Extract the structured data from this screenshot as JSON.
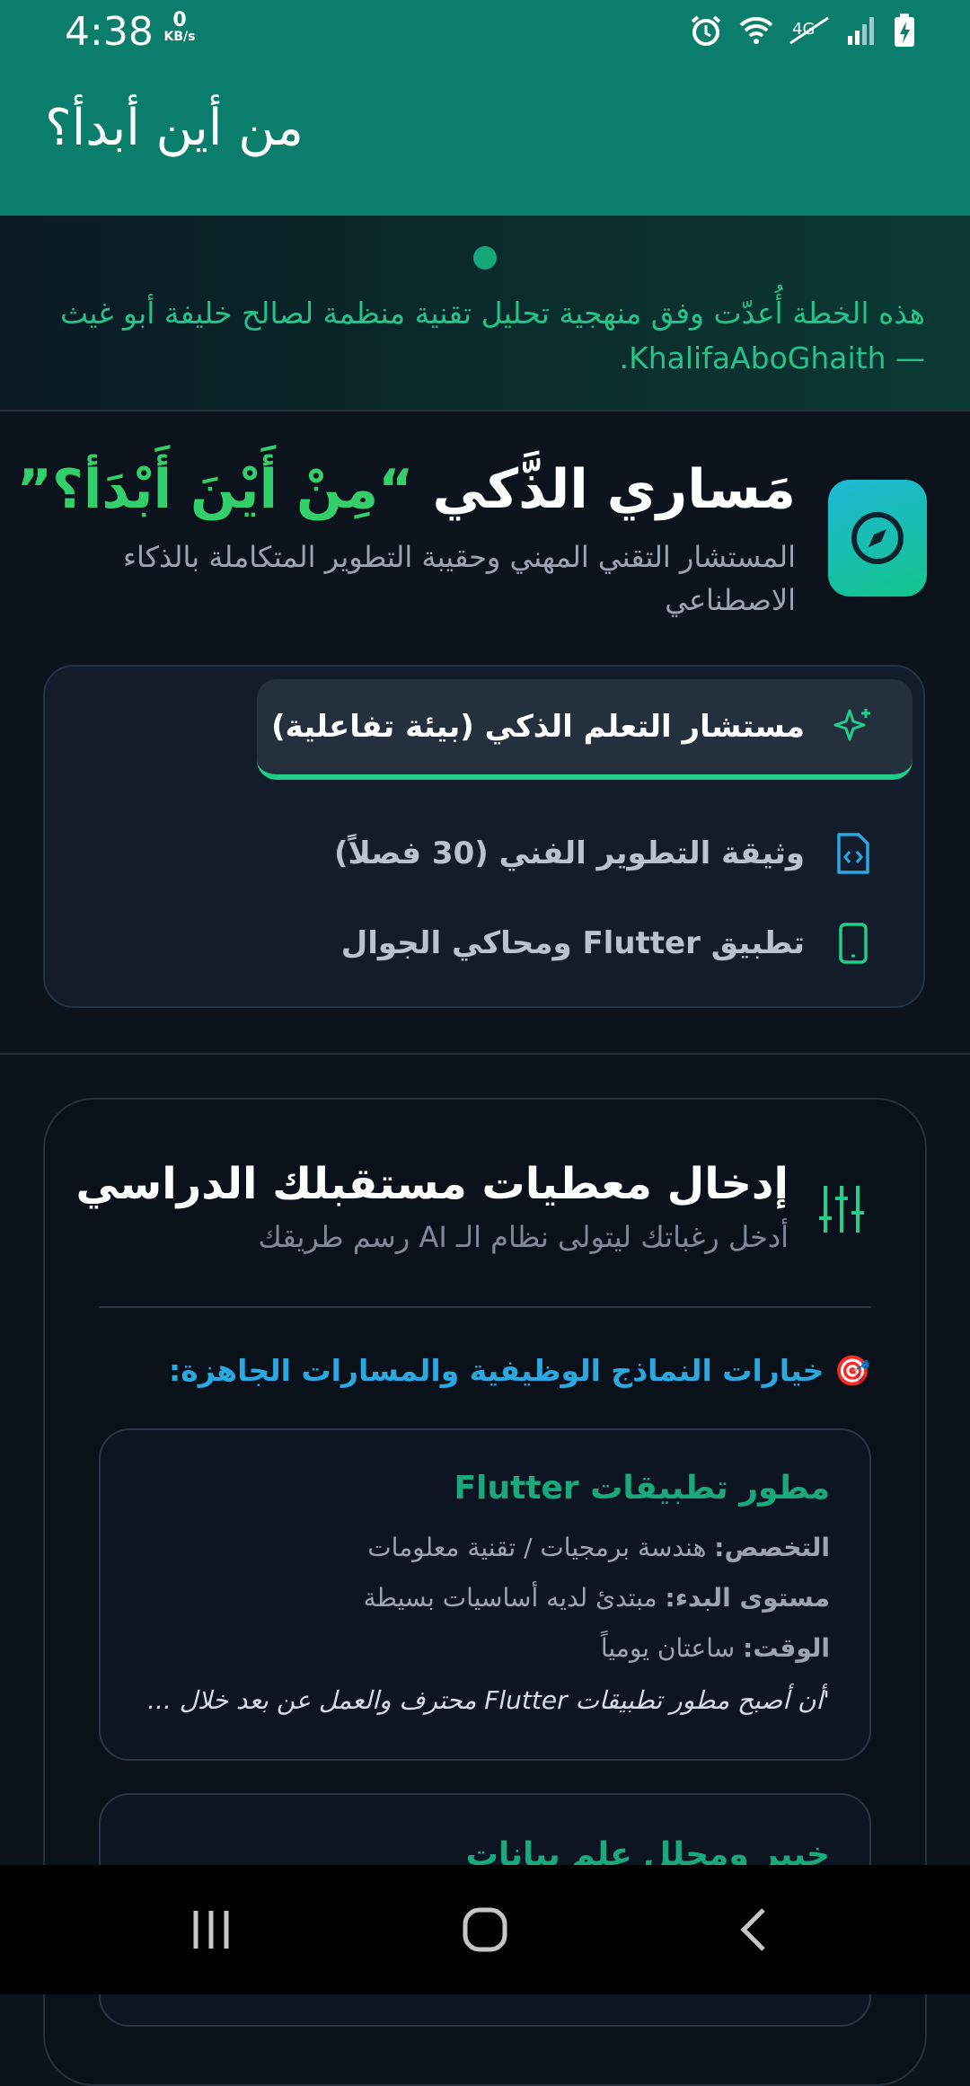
{
  "status_bar": {
    "time": "4:38",
    "net_speed_value": "0",
    "net_speed_unit": "KB/s",
    "icons": [
      "alarm-icon",
      "wifi-icon",
      "mobile-data-4g-icon",
      "signal-icon",
      "battery-charging-icon"
    ]
  },
  "app_bar": {
    "title": "من أين أبدأ؟"
  },
  "banner": {
    "text": "هذه الخطة أُعدّت وفق منهجية تحليل تقنية منظمة لصالح خليفة أبو غيث — KhalifaAboGhaith."
  },
  "header": {
    "title_main": "مَساري الذَّكي",
    "title_highlight": "“مِنْ أَيْنَ أَبْدَأ؟”",
    "subtitle": "المستشار التقني المهني وحقيبة التطوير المتكاملة بالذكاء الاصطناعي",
    "logo_icon": "compass-icon"
  },
  "nav": {
    "items": [
      {
        "label": "مستشار التعلم الذكي (بيئة تفاعلية)",
        "icon": "sparkles-icon",
        "active": true
      },
      {
        "label": "وثيقة التطوير الفني (30 فصلاً)",
        "icon": "file-code-icon",
        "active": false
      },
      {
        "label": "تطبيق Flutter ومحاكي الجوال",
        "icon": "smartphone-icon",
        "active": false
      }
    ]
  },
  "input_section": {
    "title": "إدخال معطيات مستقبلك الدراسي",
    "subtitle": "أدخل رغباتك ليتولى نظام الـ AI رسم طريقك",
    "options_title": "🎯 خيارات النماذج الوظيفية والمسارات الجاهزة:",
    "profiles": [
      {
        "title": "مطور تطبيقات Flutter",
        "specialty_label": "التخصص:",
        "specialty_value": "هندسة برمجيات / تقنية معلومات",
        "level_label": "مستوى البدء:",
        "level_value": "مبتدئ لديه أساسيات بسيطة",
        "time_label": "الوقت:",
        "time_value": "ساعتان يومياً",
        "quote": "'أن أصبح مطور تطبيقات Flutter محترف والعمل عن بعد خلال ..."
      },
      {
        "title": "خبير ومحلل علم بيانات"
      }
    ]
  },
  "colors": {
    "app_bar": "#0a7d6c",
    "accent_green": "#1fcf8a",
    "highlight_green": "#33cf6b",
    "options_blue": "#2aa8e0",
    "background": "#0d131d"
  }
}
